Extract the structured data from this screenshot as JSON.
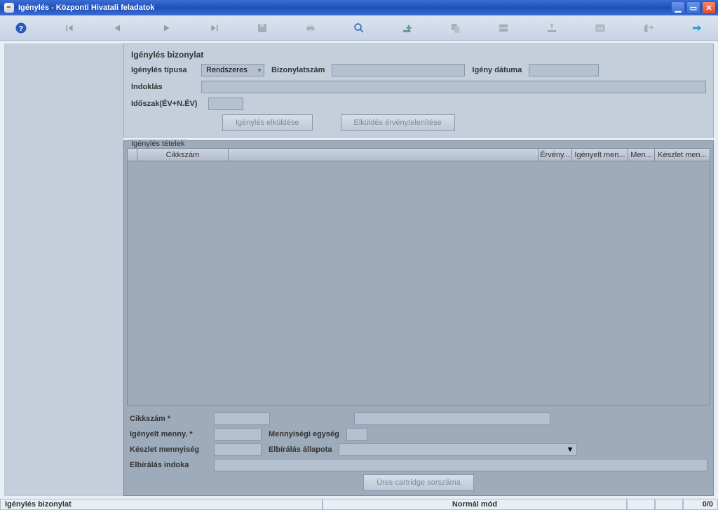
{
  "titlebar": {
    "title": "Igénylés  - Központi Hivatali feladatok"
  },
  "toolbar": {
    "icons": [
      "help",
      "first",
      "prev",
      "next",
      "last",
      "save",
      "print",
      "find",
      "add",
      "copy",
      "rename",
      "lookup",
      "ok",
      "exit",
      "forward"
    ]
  },
  "panel_top": {
    "legend": "Igénylés bizonylat",
    "labels": {
      "type": "Igénylés típusa",
      "docnum": "Bizonylatszám",
      "reqdate": "Igény dátuma",
      "reason": "Indoklás",
      "period": "Időszak(ÉV+N.ÉV)"
    },
    "type_value": "Rendszeres",
    "buttons": {
      "send": "Igénylés elküldése",
      "cancel": "Elküldés érvénytelenítése"
    }
  },
  "panel_items": {
    "legend": "Igénylés tételek",
    "headers": {
      "cikkszam": "Cikkszám",
      "blank": "",
      "erveny": "Érvény...",
      "igenyelt": "Igényelt men...",
      "menn": "Men...",
      "keszlet": "Készlet men..."
    },
    "labels": {
      "cikkszam": "Cikkszám *",
      "igenyelt": "Igényelt menny. *",
      "mennyiseg_egyseg": "Mennyiségi egység",
      "keszlet_menny": "Készlet mennyiség",
      "elbiralas_allapota": "Elbírálás állapota",
      "elbiralas_indoka": "Elbírálás indoka"
    },
    "button": "Üres cartridge sorszáma"
  },
  "statusbar": {
    "left": "Igénylés bizonylat",
    "mode": "Normál mód",
    "count": "0/0"
  }
}
